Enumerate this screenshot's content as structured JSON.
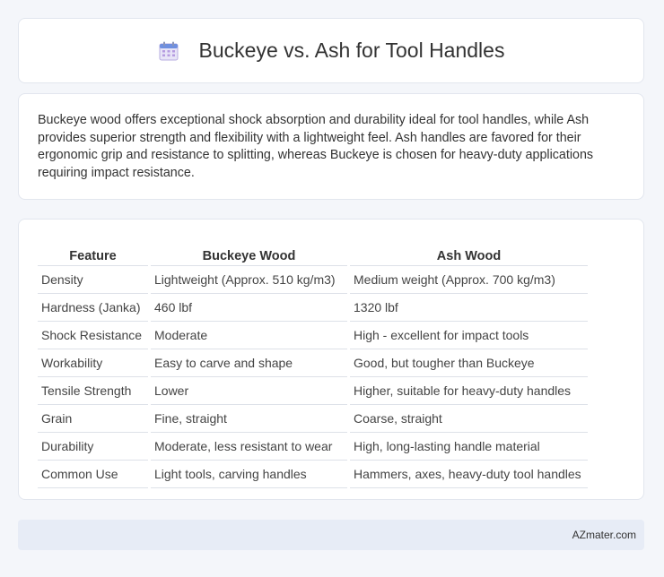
{
  "header": {
    "title": "Buckeye vs. Ash for Tool Handles",
    "icon": "calendar-icon"
  },
  "intro": {
    "text": "Buckeye wood offers exceptional shock absorption and durability ideal for tool handles, while Ash provides superior strength and flexibility with a lightweight feel. Ash handles are favored for their ergonomic grip and resistance to splitting, whereas Buckeye is chosen for heavy-duty applications requiring impact resistance."
  },
  "table": {
    "headers": [
      "Feature",
      "Buckeye Wood",
      "Ash Wood"
    ],
    "rows": [
      [
        "Density",
        "Lightweight (Approx. 510 kg/m3)",
        "Medium weight (Approx. 700 kg/m3)"
      ],
      [
        "Hardness (Janka)",
        "460 lbf",
        "1320 lbf"
      ],
      [
        "Shock Resistance",
        "Moderate",
        "High - excellent for impact tools"
      ],
      [
        "Workability",
        "Easy to carve and shape",
        "Good, but tougher than Buckeye"
      ],
      [
        "Tensile Strength",
        "Lower",
        "Higher, suitable for heavy-duty handles"
      ],
      [
        "Grain",
        "Fine, straight",
        "Coarse, straight"
      ],
      [
        "Durability",
        "Moderate, less resistant to wear",
        "High, long-lasting handle material"
      ],
      [
        "Common Use",
        "Light tools, carving handles",
        "Hammers, axes, heavy-duty tool handles"
      ]
    ]
  },
  "footer": {
    "text": "AZmater.com"
  }
}
